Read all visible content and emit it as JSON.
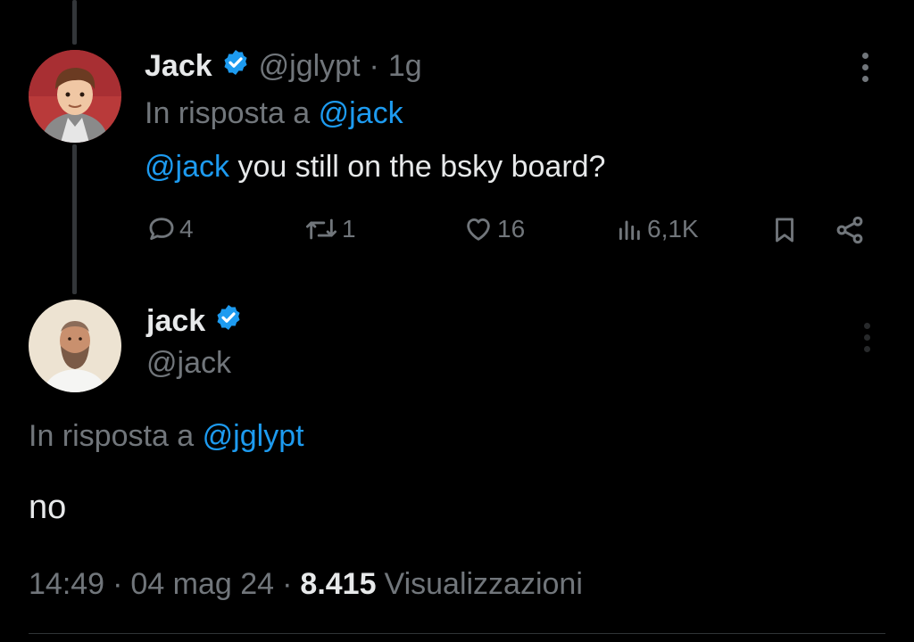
{
  "reply_tweet": {
    "display_name": "Jack",
    "handle": "@jglypt",
    "separator": "·",
    "time": "1g",
    "reply_prefix": "In risposta a",
    "reply_to": "@jack",
    "text_mention": "@jack",
    "text": "you still on the bsky board?",
    "counts": {
      "replies": "4",
      "retweets": "1",
      "likes": "16",
      "views": "6,1K"
    },
    "icons": [
      "reply-icon",
      "retweet-icon",
      "like-icon",
      "views-icon",
      "bookmark-icon",
      "share-icon",
      "more-icon",
      "verified-icon"
    ]
  },
  "main_tweet": {
    "display_name": "jack",
    "handle": "@jack",
    "reply_prefix": "In risposta a",
    "reply_to": "@jglypt",
    "text": "no",
    "time": "14:49",
    "sep1": "·",
    "date": "04 mag 24",
    "sep2": "·",
    "views_count": "8.415",
    "views_label": "Visualizzazioni"
  },
  "colors": {
    "background": "#000000",
    "text": "#e7e9ea",
    "muted": "#71767b",
    "link": "#1d9bf0",
    "verified": "#1d9bf0"
  }
}
